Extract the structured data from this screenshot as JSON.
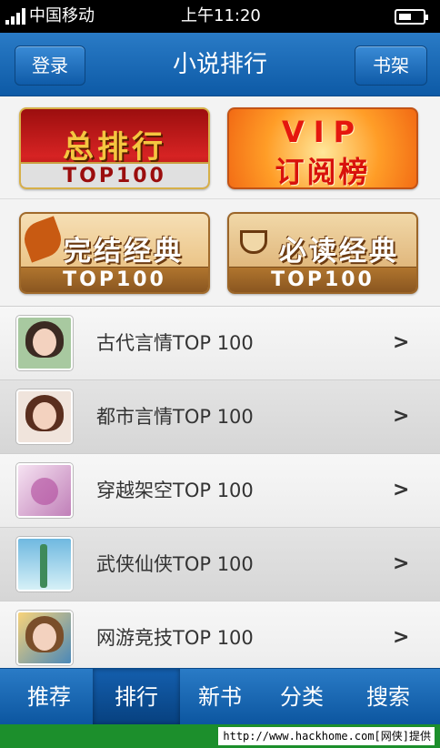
{
  "status_bar": {
    "carrier": "中国移动",
    "time": "上午11:20",
    "battery_level": 0.55,
    "signal_bars": 4
  },
  "header": {
    "left_button": "登录",
    "title": "小说排行",
    "right_button": "书架"
  },
  "banners": [
    {
      "title": "总排行",
      "badge": "TOP100"
    },
    {
      "title_line1": "VIP",
      "title_line2": "订阅榜"
    },
    {
      "title": "完结经典",
      "badge": "TOP100"
    },
    {
      "title": "必读经典",
      "badge": "TOP100"
    }
  ],
  "list": {
    "items": [
      {
        "label": "古代言情TOP 100"
      },
      {
        "label": "都市言情TOP 100"
      },
      {
        "label": "穿越架空TOP 100"
      },
      {
        "label": "武侠仙侠TOP 100"
      },
      {
        "label": "网游竞技TOP 100"
      }
    ],
    "chevron": ">"
  },
  "tabbar": {
    "tabs": [
      {
        "label": "推荐",
        "active": false
      },
      {
        "label": "排行",
        "active": true
      },
      {
        "label": "新书",
        "active": false
      },
      {
        "label": "分类",
        "active": false
      },
      {
        "label": "搜索",
        "active": false
      }
    ]
  },
  "watermark": {
    "text": "http://www.hackhome.com[网侠]提供"
  },
  "colors": {
    "header_blue": "#0d5aa6",
    "tab_active": "#07407e",
    "watermark_green": "#1c8f2c"
  }
}
